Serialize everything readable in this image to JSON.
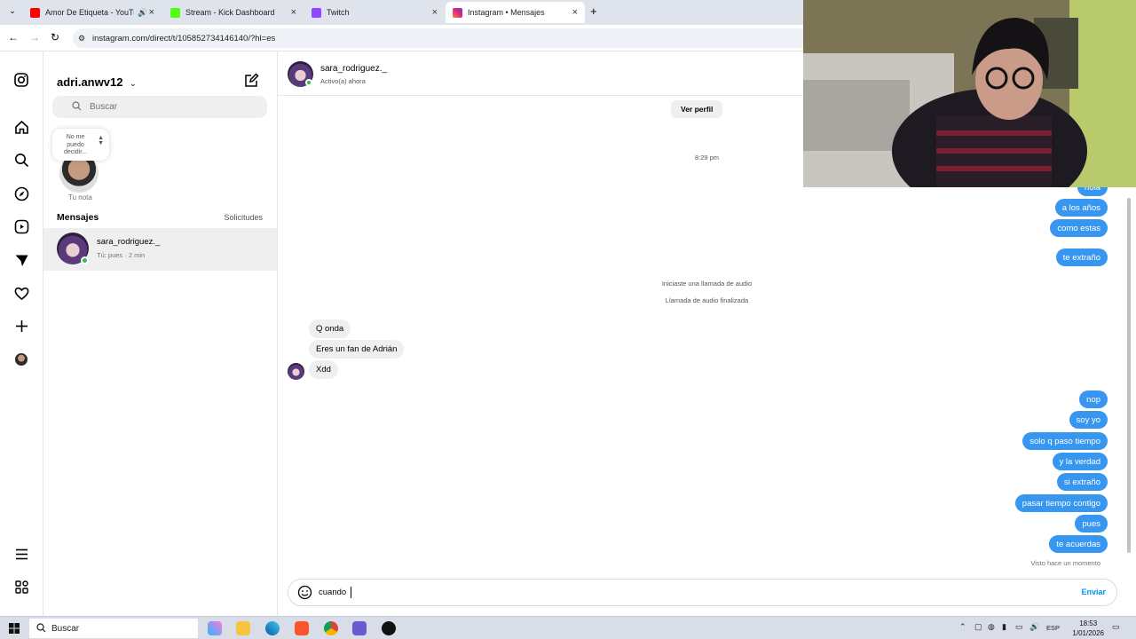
{
  "browser": {
    "tabs": [
      {
        "title": "Amor De Etiqueta - YouTube",
        "favicon_color": "#ff0000"
      },
      {
        "title": "Stream - Kick Dashboard",
        "favicon_color": "#53fc18"
      },
      {
        "title": "Twitch",
        "favicon_color": "#9146ff"
      },
      {
        "title": "Instagram • Mensajes",
        "favicon_color": "#e1306c"
      }
    ],
    "url": "instagram.com/direct/t/105852734146140/?hl=es"
  },
  "inbox": {
    "username": "adri.anwv12",
    "search_placeholder": "Buscar",
    "note_text": "No me puedo decidir...",
    "note_label": "Tu nota",
    "messages_title": "Mensajes",
    "requests_label": "Solicitudes",
    "conversation": {
      "name": "sara_rodriguez._",
      "preview": "Tú: pues · 2 min"
    }
  },
  "chat": {
    "name": "sara_rodriguez._",
    "status": "Activo(a) ahora",
    "view_profile": "Ver perfil",
    "time": "8:29 pm",
    "outgoing_top": [
      "hola",
      "a los años",
      "como estas",
      "te extraño"
    ],
    "call_started": "Iniciaste una llamada de audio",
    "call_ended": "Llamada de audio finalizada",
    "incoming": [
      "Q onda",
      "Eres un fan de Adrián",
      "Xdd"
    ],
    "outgoing_bottom": [
      "nop",
      "soy yo",
      "solo q paso tiempo",
      "y la verdad",
      "si extraño",
      "pasar tiempo contigo",
      "pues",
      "te acuerdas"
    ],
    "seen": "Visto hace un momento",
    "composer_value": "cuando",
    "send": "Enviar"
  },
  "taskbar": {
    "search": "Buscar",
    "lang": "ESP",
    "time": "18:53",
    "date": "1/01/2026"
  },
  "colors": {
    "accent": "#0095f6",
    "outgoing_bubble": "#3797f0",
    "online": "#2fbf4f"
  }
}
